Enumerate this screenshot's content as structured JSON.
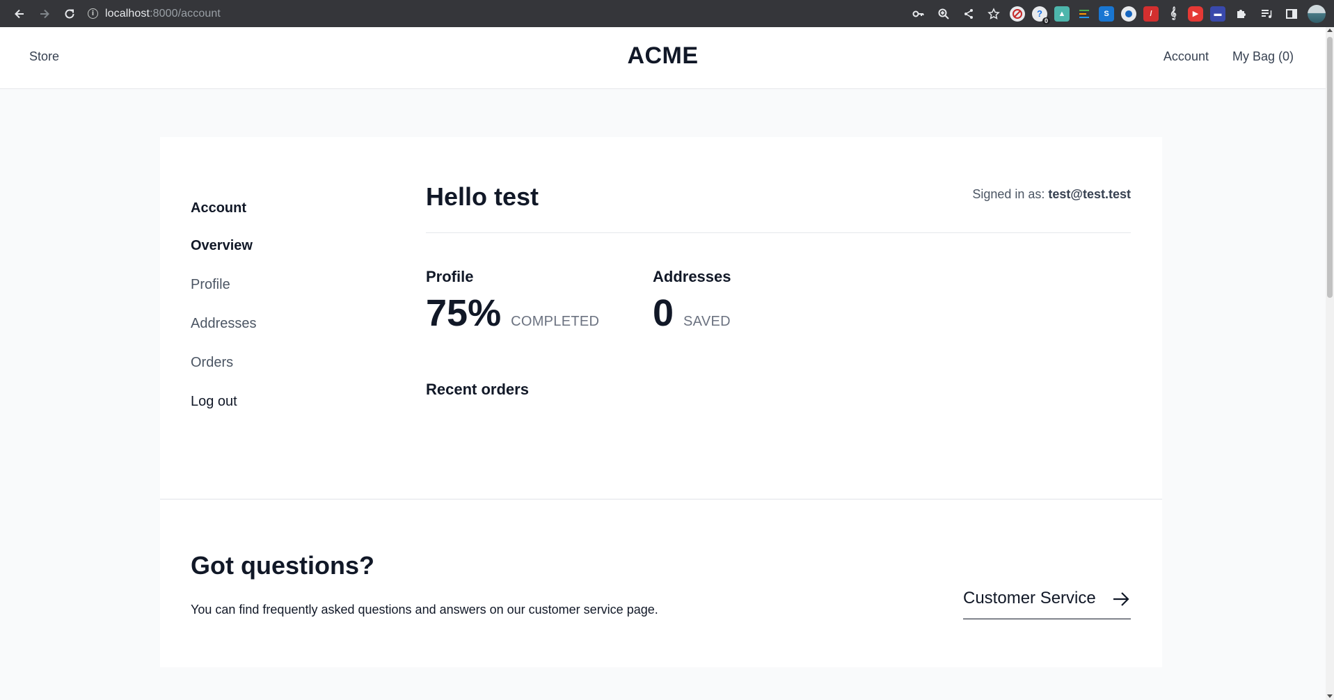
{
  "browser": {
    "url_host": "localhost",
    "url_path": ":8000/account",
    "extensions": [
      "blocked-icon",
      "badge-icon",
      "tag-icon",
      "menu-icon",
      "s-icon",
      "circle-icon",
      "red-icon",
      "clef-icon",
      "youtube-icon",
      "screen-icon",
      "puzzle-icon",
      "queue-icon",
      "sidepanel-icon"
    ],
    "badge_count": "0"
  },
  "header": {
    "store_label": "Store",
    "logo": "ACME",
    "account_label": "Account",
    "bag_label": "My Bag (0)"
  },
  "sidebar": {
    "title": "Account",
    "items": [
      {
        "label": "Overview",
        "active": true
      },
      {
        "label": "Profile"
      },
      {
        "label": "Addresses"
      },
      {
        "label": "Orders"
      },
      {
        "label": "Log out"
      }
    ]
  },
  "main": {
    "greeting": "Hello test",
    "signed_in_prefix": "Signed in as: ",
    "signed_in_email": "test@test.test",
    "profile": {
      "title": "Profile",
      "value": "75%",
      "unit": "COMPLETED"
    },
    "addresses": {
      "title": "Addresses",
      "value": "0",
      "unit": "SAVED"
    },
    "recent_orders_title": "Recent orders"
  },
  "help": {
    "title": "Got questions?",
    "text": "You can find frequently asked questions and answers on our customer service page.",
    "link_label": "Customer Service"
  },
  "colors": {
    "chrome_bg": "#35363a",
    "page_bg": "#f9fafb",
    "text_dark": "#111827",
    "text_muted": "#6b7280"
  }
}
